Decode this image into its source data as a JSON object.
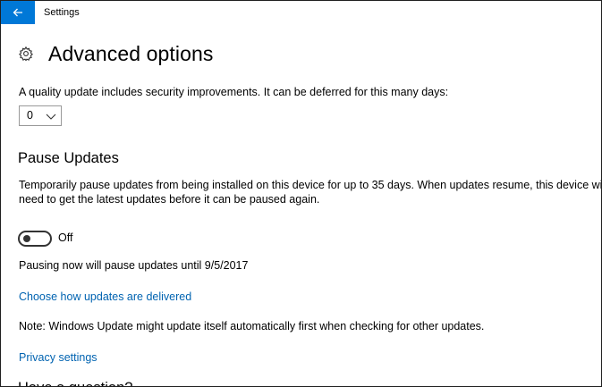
{
  "window": {
    "title": "Settings"
  },
  "header": {
    "title": "Advanced options",
    "icon": "gear-icon"
  },
  "quality_update": {
    "description": "A quality update includes security improvements. It can be deferred for this many days:",
    "selected_value": "0"
  },
  "pause_updates": {
    "title": "Pause Updates",
    "description_line1": "Temporarily pause updates from being installed on this device for up to 35 days. When updates resume, this device will",
    "description_line2": "need to get the latest updates before it can be paused again.",
    "toggle_label": "Off",
    "toggle_on": false,
    "status": "Pausing now will pause updates until 9/5/2017"
  },
  "links": {
    "delivery": "Choose how updates are delivered",
    "privacy": "Privacy settings"
  },
  "note": "Note: Windows Update might update itself automatically first when checking for other updates.",
  "next_section_partial": "Have a question?",
  "colors": {
    "accent": "#0078d7",
    "link": "#0063b1"
  }
}
